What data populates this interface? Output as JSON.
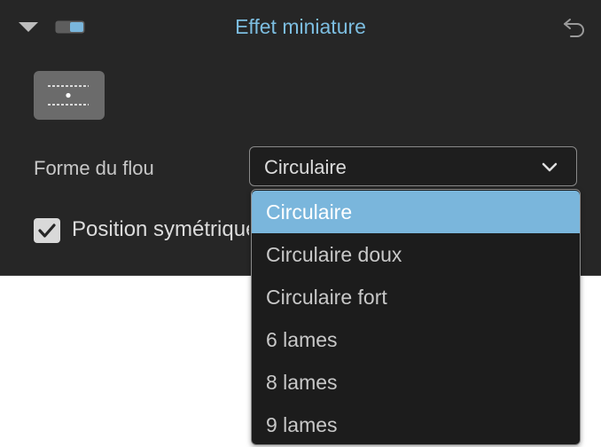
{
  "panel": {
    "title": "Effet miniature",
    "icons": {
      "collapse": "triangle-down-icon",
      "toggle": "toggle-switch-icon",
      "reset": "undo-icon",
      "preset": "tilt-shift-linear-icon"
    },
    "colors": {
      "background": "#262626",
      "title": "#7cbde0",
      "accent": "#7ab6dc"
    }
  },
  "blur_shape": {
    "label": "Forme du flou",
    "value": "Circulaire",
    "options": [
      "Circulaire",
      "Circulaire doux",
      "Circulaire fort",
      "6 lames",
      "8 lames",
      "9 lames"
    ],
    "selected_index": 0
  },
  "symmetric": {
    "label": "Position symétrique",
    "checked": true
  }
}
